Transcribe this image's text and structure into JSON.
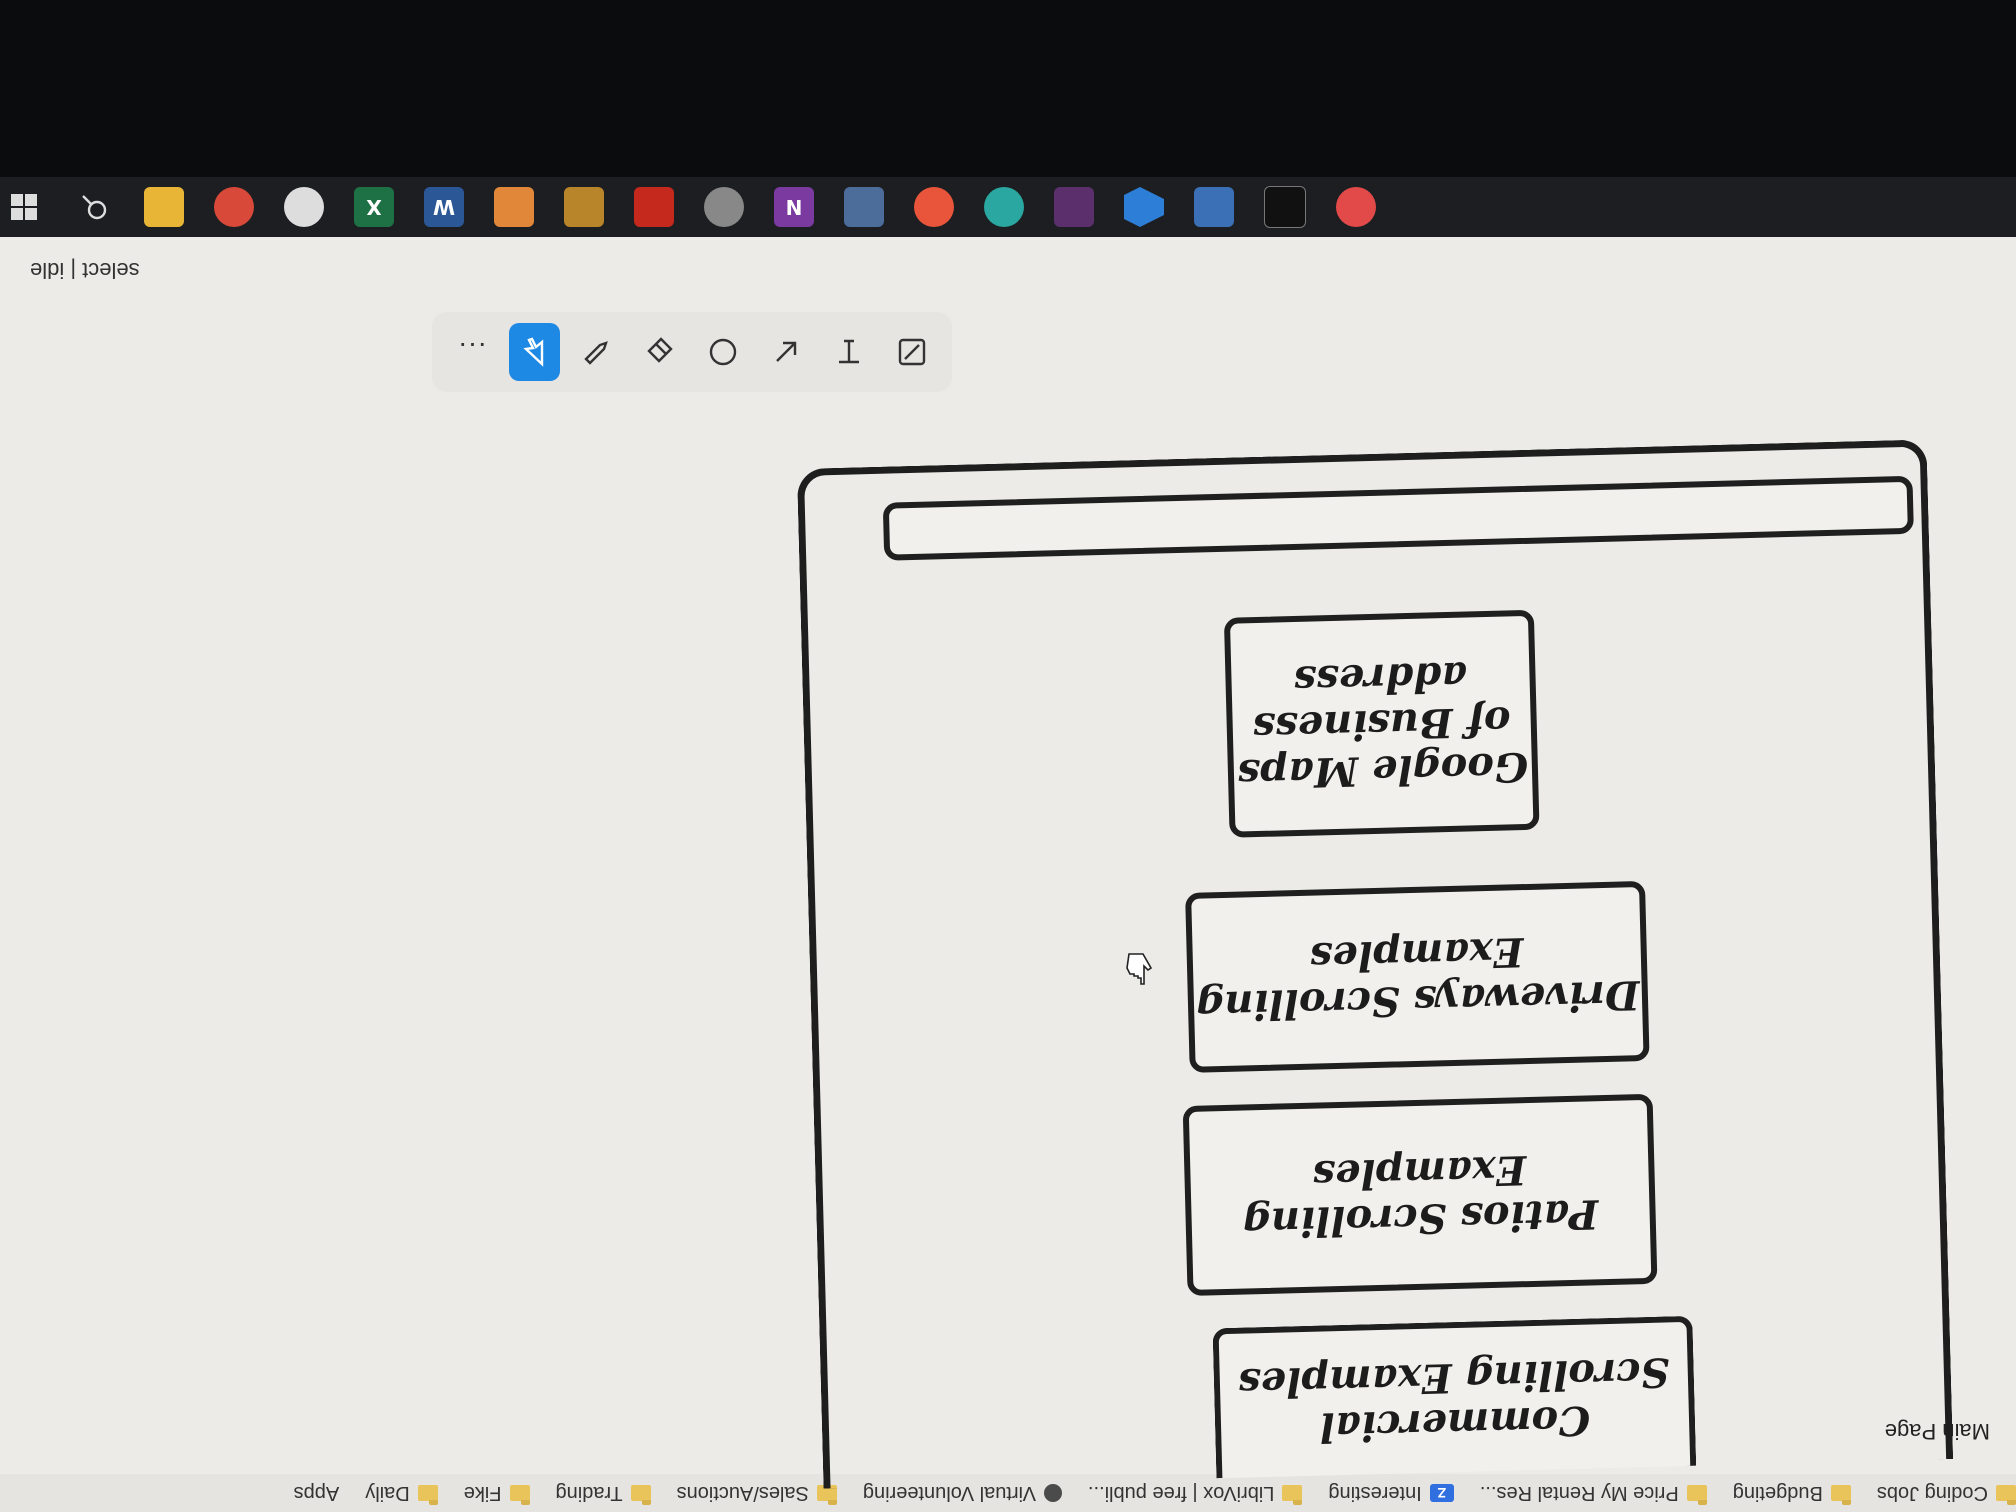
{
  "bookmarks": {
    "items": [
      {
        "label": "Coding Jobs",
        "icon": "folder-icon"
      },
      {
        "label": "Budgeting",
        "icon": "folder-icon"
      },
      {
        "label": "Price My Rental Res...",
        "icon": "zillow-icon"
      },
      {
        "label": "Interesting",
        "icon": "folder-icon"
      },
      {
        "label": "LibriVox | free publi...",
        "icon": "folder-icon"
      },
      {
        "label": "Virtual Volunteering",
        "icon": "librivox-icon"
      },
      {
        "label": "Sales/Auctions",
        "icon": "folder-icon"
      },
      {
        "label": "Trading",
        "icon": "folder-icon"
      },
      {
        "label": "Fike",
        "icon": "folder-icon"
      },
      {
        "label": "Daily",
        "icon": "folder-icon"
      },
      {
        "label": "Apps",
        "icon": "apps-icon"
      }
    ]
  },
  "app": {
    "title": "Main Page",
    "status": "select | idle"
  },
  "drawing": {
    "cards": {
      "commercial": "Commercial Scrolling Examples",
      "patios": "Patios Scrolling Examples",
      "driveways": "Driveways Scrolling Examples",
      "google": "Google Maps of Business address"
    }
  },
  "toolbar": {
    "tools": [
      "select-tool",
      "draw-tool",
      "erase-tool",
      "ellipse-tool",
      "arrow-tool",
      "text-tool",
      "sticky-tool"
    ],
    "active": "select-tool",
    "more_label": "...",
    "accent": "#1e88e5"
  },
  "taskbar": {
    "icons": [
      "windows-start-icon",
      "search-icon",
      "file-explorer-icon",
      "chrome-icon",
      "chrome-icon-2",
      "excel-icon",
      "word-icon",
      "illustrator-icon",
      "vectorworks-icon",
      "acrobat-icon",
      "app-icon",
      "onenote-icon",
      "monitor-icon",
      "sublime-icon",
      "onbase-icon",
      "slack-icon",
      "vscode-icon",
      "clipboard-icon",
      "terminal-icon",
      "photo-icon"
    ],
    "labels": {
      "excel": "X",
      "word": "W",
      "onenote": "N"
    }
  }
}
